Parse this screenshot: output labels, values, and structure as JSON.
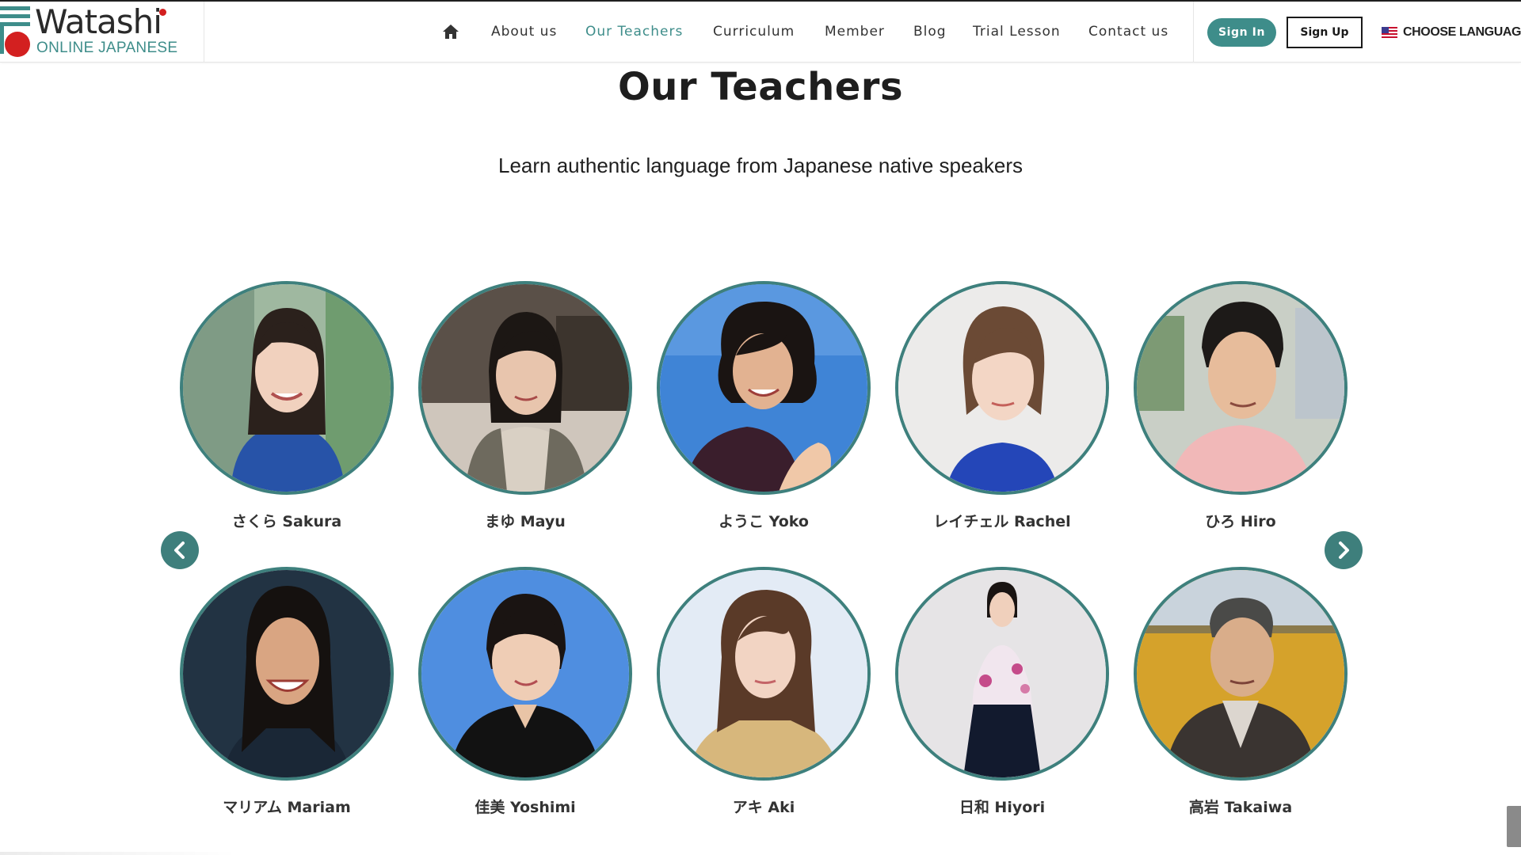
{
  "brand": {
    "name": "Watashi",
    "subtitle": "ONLINE JAPANESE",
    "colors": {
      "teal": "#3e8d8a",
      "red": "#d32020",
      "dark": "#2a2a2a"
    }
  },
  "nav": {
    "home_icon": "home-icon",
    "items": [
      {
        "label": "About us",
        "active": false
      },
      {
        "label": "Our Teachers",
        "active": true
      },
      {
        "label": "Curriculum",
        "active": false
      },
      {
        "label": "Member",
        "active": false
      },
      {
        "label": "Blog",
        "active": false
      },
      {
        "label": "Trial Lesson",
        "active": false
      },
      {
        "label": "Contact us",
        "active": false
      }
    ]
  },
  "auth": {
    "signin_label": "Sign In",
    "signup_label": "Sign Up"
  },
  "language": {
    "label": "CHOOSE LANGUAGE",
    "flag_icon": "us-flag-icon"
  },
  "page": {
    "title": "Our Teachers",
    "subtitle": "Learn authentic language from Japanese native speakers"
  },
  "carousel": {
    "prev_icon": "chevron-left-icon",
    "next_icon": "chevron-right-icon",
    "teachers": [
      {
        "name": "さくら Sakura"
      },
      {
        "name": "まゆ Mayu"
      },
      {
        "name": "ようこ Yoko"
      },
      {
        "name": "レイチェル Rachel"
      },
      {
        "name": "ひろ Hiro"
      },
      {
        "name": "マリアム Mariam"
      },
      {
        "name": "佳美 Yoshimi"
      },
      {
        "name": "アキ Aki"
      },
      {
        "name": "日和 Hiyori"
      },
      {
        "name": "高岩 Takaiwa"
      }
    ]
  }
}
